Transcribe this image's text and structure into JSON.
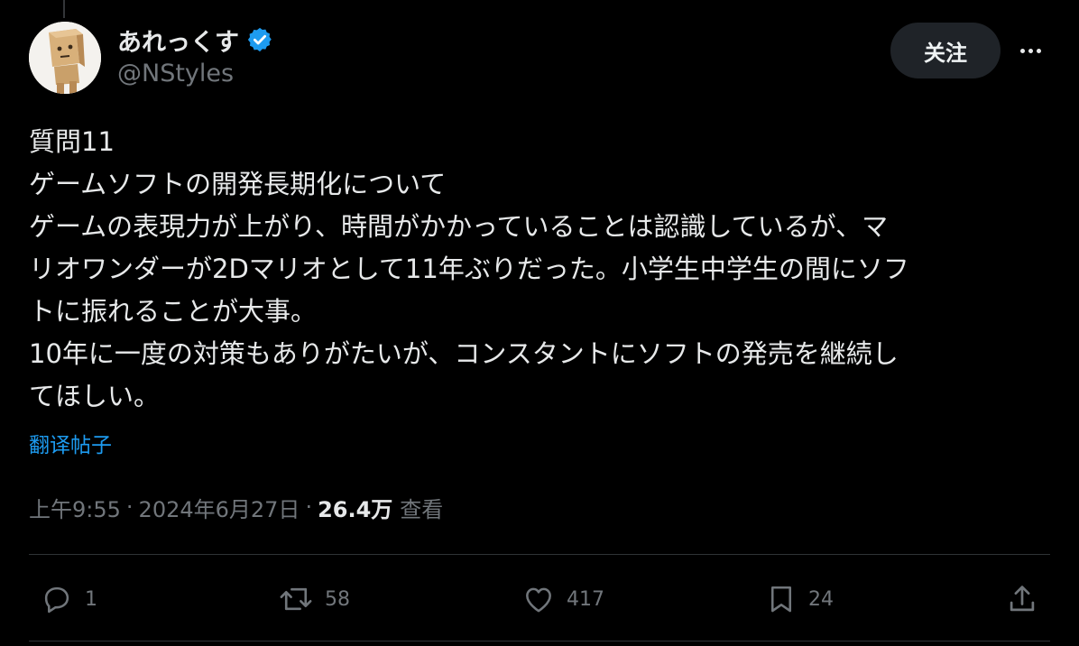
{
  "author": {
    "display_name": "あれっくす",
    "handle": "@NStyles",
    "verified": true,
    "verified_color": "#1d9bf0"
  },
  "header": {
    "follow_label": "关注"
  },
  "tweet": {
    "lines": [
      "質問11",
      "ゲームソフトの開発長期化について",
      "ゲームの表現力が上がり、時間がかかっていることは認識しているが、マ",
      "リオワンダーが2Dマリオとして11年ぶりだった。小学生中学生の間にソフ",
      "トに振れることが大事。",
      "10年に一度の対策もありがたいが、コンスタントにソフトの発売を継続し",
      "てほしい。"
    ],
    "translate_label": "翻译帖子"
  },
  "meta": {
    "time": "上午9:55",
    "date": "2024年6月27日",
    "separator": "·",
    "views_count": "26.4万",
    "views_label": "查看"
  },
  "actions": {
    "reply_icon": "reply-icon",
    "reply_count": "1",
    "repost_icon": "repost-icon",
    "repost_count": "58",
    "like_icon": "heart-icon",
    "like_count": "417",
    "bookmark_icon": "bookmark-icon",
    "bookmark_count": "24",
    "share_icon": "share-icon"
  },
  "colors": {
    "background": "#000000",
    "text_primary": "#e7e9ea",
    "text_secondary": "#71767b",
    "link": "#1d9bf0",
    "follow_button_bg": "#1f2328",
    "divider": "#2f3336"
  }
}
